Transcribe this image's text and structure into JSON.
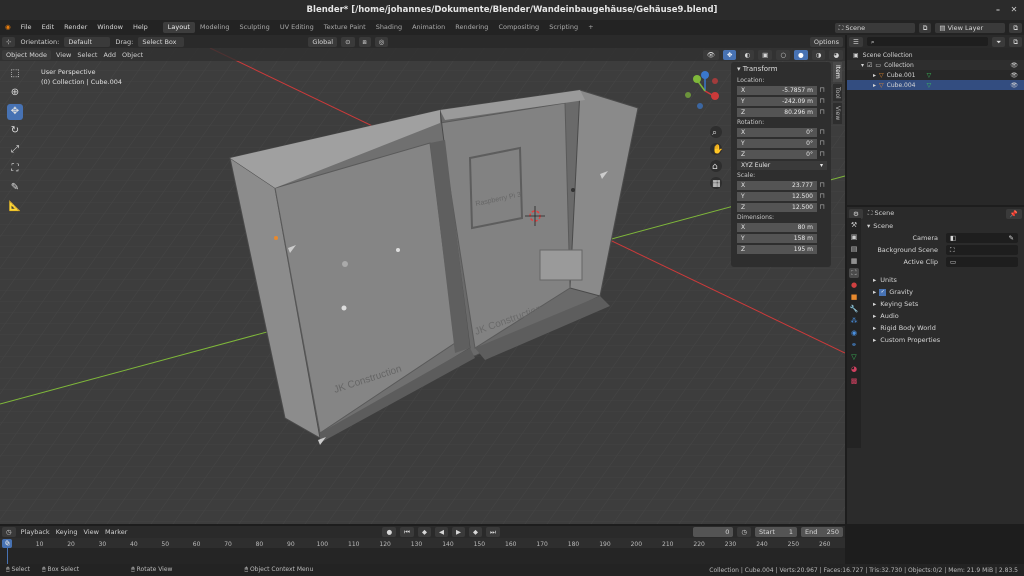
{
  "title": "Blender* [/home/johannes/Dokumente/Blender/Wandeinbaugehäuse/Gehäuse9.blend]",
  "menu": [
    "File",
    "Edit",
    "Render",
    "Window",
    "Help"
  ],
  "workspaces": [
    "Layout",
    "Modeling",
    "Sculpting",
    "UV Editing",
    "Texture Paint",
    "Shading",
    "Animation",
    "Rendering",
    "Compositing",
    "Scripting"
  ],
  "scene": {
    "label": "Scene",
    "view_layer": "View Layer"
  },
  "tool_header": {
    "orientation_label": "Orientation:",
    "orientation_value": "Default",
    "drag_label": "Drag:",
    "drag_value": "Select Box",
    "transform": "Global",
    "options": "Options"
  },
  "viewport_header": {
    "mode": "Object Mode",
    "menus": [
      "View",
      "Select",
      "Add",
      "Object"
    ]
  },
  "viewport_info": {
    "line1": "User Perspective",
    "line2": "(0) Collection | Cube.004"
  },
  "model_text": {
    "left": "JK Construction",
    "right": "JK Construction",
    "raspberry": "Raspberry Pi 3"
  },
  "npanel": {
    "title": "Transform",
    "location_label": "Location:",
    "location": [
      {
        "axis": "X",
        "value": "-5.7857 m"
      },
      {
        "axis": "Y",
        "value": "-242.09 m"
      },
      {
        "axis": "Z",
        "value": "80.296 m"
      }
    ],
    "rotation_label": "Rotation:",
    "rotation": [
      {
        "axis": "X",
        "value": "0°"
      },
      {
        "axis": "Y",
        "value": "0°"
      },
      {
        "axis": "Z",
        "value": "0°"
      }
    ],
    "rotation_mode": "XYZ Euler",
    "scale_label": "Scale:",
    "scale": [
      {
        "axis": "X",
        "value": "23.777"
      },
      {
        "axis": "Y",
        "value": "12.500"
      },
      {
        "axis": "Z",
        "value": "12.500"
      }
    ],
    "dimensions_label": "Dimensions:",
    "dimensions": [
      {
        "axis": "X",
        "value": "80 m"
      },
      {
        "axis": "Y",
        "value": "158 m"
      },
      {
        "axis": "Z",
        "value": "195 m"
      }
    ],
    "tabs": [
      "Item",
      "Tool",
      "View"
    ]
  },
  "outliner": {
    "root": "Scene Collection",
    "collection": "Collection",
    "items": [
      "Cube.001",
      "Cube.004"
    ]
  },
  "properties": {
    "context": "Scene",
    "section": "Scene",
    "camera_label": "Camera",
    "background_label": "Background Scene",
    "active_clip_label": "Active Clip",
    "panels": [
      "Units",
      "Gravity",
      "Keying Sets",
      "Audio",
      "Rigid Body World",
      "Custom Properties"
    ]
  },
  "timeline": {
    "menus": [
      "Playback",
      "Keying",
      "View",
      "Marker"
    ],
    "current": "0",
    "start_label": "Start",
    "start": "1",
    "end_label": "End",
    "end": "250",
    "ticks": [
      "0",
      "10",
      "20",
      "30",
      "40",
      "50",
      "60",
      "70",
      "80",
      "90",
      "100",
      "110",
      "120",
      "130",
      "140",
      "150",
      "160",
      "170",
      "180",
      "190",
      "200",
      "210",
      "220",
      "230",
      "240",
      "250",
      "260"
    ]
  },
  "status": {
    "select": "Select",
    "box_select": "Box Select",
    "rotate": "Rotate View",
    "context": "Object Context Menu",
    "stats": "Collection | Cube.004 | Verts:20.967 | Faces:16.727 | Tris:32.730 | Objects:0/2 | Mem: 21.9 MiB | 2.83.5"
  },
  "colors": {
    "accent": "#4772b3",
    "x_axis": "#cc3a3a",
    "y_axis": "#7fb83a",
    "z_axis": "#3a78cc",
    "viewport": "#3d3d3d"
  }
}
